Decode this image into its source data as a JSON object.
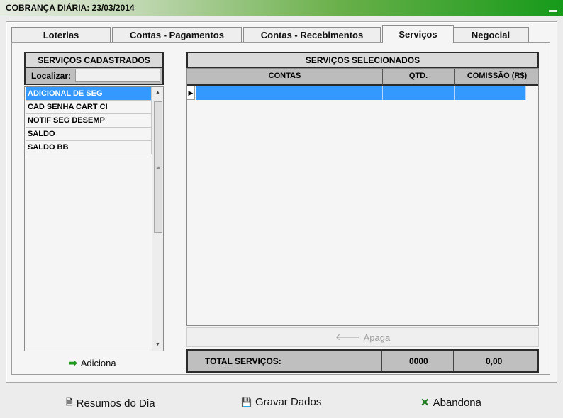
{
  "window": {
    "title": "COBRANÇA DIÁRIA: 23/03/2014"
  },
  "tabs": [
    {
      "label": "Loterias"
    },
    {
      "label": "Contas - Pagamentos"
    },
    {
      "label": "Contas - Recebimentos"
    },
    {
      "label": "Serviços",
      "active": true
    },
    {
      "label": "Negocial"
    }
  ],
  "left_panel": {
    "title": "SERVIÇOS CADASTRADOS",
    "search_label": "Localizar:",
    "search_value": "",
    "items": [
      {
        "label": "ADICIONAL DE SEG",
        "selected": true
      },
      {
        "label": "CAD SENHA CART CI"
      },
      {
        "label": "NOTIF SEG DESEMP"
      },
      {
        "label": "SALDO"
      },
      {
        "label": "SALDO BB"
      }
    ],
    "add_label": "Adiciona"
  },
  "right_panel": {
    "title": "SERVIÇOS SELECIONADOS",
    "columns": [
      "CONTAS",
      "QTD.",
      "COMISSÃO (R$)"
    ],
    "delete_label": "Apaga",
    "totals": {
      "label": "TOTAL SERVIÇOS:",
      "qty": "0000",
      "commission": "0,00"
    }
  },
  "footer": {
    "summary_label": "Resumos do Dia",
    "save_label": "Gravar Dados",
    "cancel_label": "Abandona"
  },
  "colors": {
    "accent": "#3399ff",
    "title_green": "#169a1a",
    "icon_green": "#1f9a1f"
  }
}
